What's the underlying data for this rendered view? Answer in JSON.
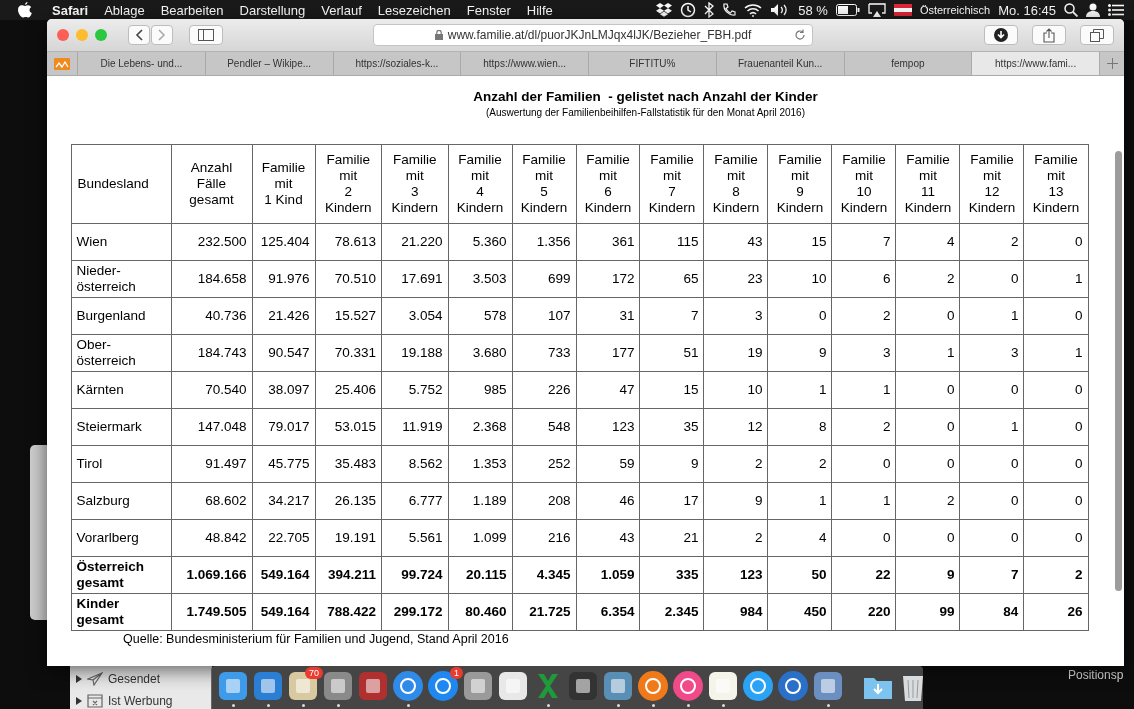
{
  "menubar": {
    "app": "Safari",
    "items": [
      "Ablage",
      "Bearbeiten",
      "Darstellung",
      "Verlauf",
      "Lesezeichen",
      "Fenster",
      "Hilfe"
    ],
    "battery": "58 %",
    "input_source": "Österreichisch",
    "clock": "Mo. 16:45"
  },
  "browser": {
    "url": "www.familie.at/dl/puorJKJnLMJqx4lJK/Bezieher_FBH.pdf",
    "tabs": [
      {
        "label": "Die Lebens- und...",
        "selected": false
      },
      {
        "label": "Pendler – Wikipe...",
        "selected": false
      },
      {
        "label": "https://soziales-k...",
        "selected": false
      },
      {
        "label": "https://www.wien...",
        "selected": false
      },
      {
        "label": "FIFTITU%",
        "selected": false
      },
      {
        "label": "Frauenanteil Kun...",
        "selected": false
      },
      {
        "label": "fempop",
        "selected": false
      },
      {
        "label": "https://www.fami...",
        "selected": true
      }
    ]
  },
  "document": {
    "title": "Anzahl der Familien  - gelistet nach Anzahl der Kinder",
    "subtitle": "(Auswertung der Familienbeihilfen-Fallstatistik für den Monat April 2016)",
    "columns": [
      "Bundesland",
      "Anzahl\nFälle\ngesamt",
      "Familie\nmit\n1 Kind",
      "Familie\nmit\n2\nKindern",
      "Familie\nmit\n3\nKindern",
      "Familie\nmit\n4\nKindern",
      "Familie\nmit\n5\nKindern",
      "Familie\nmit\n6\nKindern",
      "Familie\nmit\n7\nKindern",
      "Familie\nmit\n8\nKindern",
      "Familie\nmit\n9\nKindern",
      "Familie\nmit\n10\nKindern",
      "Familie\nmit\n11\nKindern",
      "Familie\nmit\n12\nKindern",
      "Familie\nmit\n13\nKindern"
    ],
    "rows": [
      {
        "kind": "state",
        "cells": [
          "Wien",
          "232.500",
          "125.404",
          "78.613",
          "21.220",
          "5.360",
          "1.356",
          "361",
          "115",
          "43",
          "15",
          "7",
          "4",
          "2",
          "0"
        ]
      },
      {
        "kind": "state",
        "cells": [
          "Nieder-\nösterreich",
          "184.658",
          "91.976",
          "70.510",
          "17.691",
          "3.503",
          "699",
          "172",
          "65",
          "23",
          "10",
          "6",
          "2",
          "0",
          "1"
        ]
      },
      {
        "kind": "state",
        "cells": [
          "Burgenland",
          "40.736",
          "21.426",
          "15.527",
          "3.054",
          "578",
          "107",
          "31",
          "7",
          "3",
          "0",
          "2",
          "0",
          "1",
          "0"
        ]
      },
      {
        "kind": "state",
        "cells": [
          "Ober-\nösterreich",
          "184.743",
          "90.547",
          "70.331",
          "19.188",
          "3.680",
          "733",
          "177",
          "51",
          "19",
          "9",
          "3",
          "1",
          "3",
          "1"
        ]
      },
      {
        "kind": "state",
        "cells": [
          "Kärnten",
          "70.540",
          "38.097",
          "25.406",
          "5.752",
          "985",
          "226",
          "47",
          "15",
          "10",
          "1",
          "1",
          "0",
          "0",
          "0"
        ]
      },
      {
        "kind": "state",
        "cells": [
          "Steiermark",
          "147.048",
          "79.017",
          "53.015",
          "11.919",
          "2.368",
          "548",
          "123",
          "35",
          "12",
          "8",
          "2",
          "0",
          "1",
          "0"
        ]
      },
      {
        "kind": "state",
        "cells": [
          "Tirol",
          "91.497",
          "45.775",
          "35.483",
          "8.562",
          "1.353",
          "252",
          "59",
          "9",
          "2",
          "2",
          "0",
          "0",
          "0",
          "0"
        ]
      },
      {
        "kind": "state",
        "cells": [
          "Salzburg",
          "68.602",
          "34.217",
          "26.135",
          "6.777",
          "1.189",
          "208",
          "46",
          "17",
          "9",
          "1",
          "1",
          "2",
          "0",
          "0"
        ]
      },
      {
        "kind": "state",
        "cells": [
          "Vorarlberg",
          "48.842",
          "22.705",
          "19.191",
          "5.561",
          "1.099",
          "216",
          "43",
          "21",
          "2",
          "4",
          "0",
          "0",
          "0",
          "0"
        ]
      },
      {
        "kind": "total",
        "cells": [
          "Österreich\ngesamt",
          "1.069.166",
          "549.164",
          "394.211",
          "99.724",
          "20.115",
          "4.345",
          "1.059",
          "335",
          "123",
          "50",
          "22",
          "9",
          "7",
          "2"
        ]
      },
      {
        "kind": "total",
        "cells": [
          "Kinder\ngesamt",
          "1.749.505",
          "549.164",
          "788.422",
          "299.172",
          "80.460",
          "21.725",
          "6.354",
          "2.345",
          "984",
          "450",
          "220",
          "99",
          "84",
          "26"
        ]
      }
    ],
    "source": "Quelle: Bundesministerium für Familien und Jugend, Stand April 2016"
  },
  "mail": {
    "folders": [
      "Gesendet",
      "Ist Werbung"
    ]
  },
  "side_text": "Positionsp",
  "dock": {
    "items": [
      {
        "running": true
      },
      {
        "running": true
      },
      {
        "running": true,
        "badge": "70"
      },
      {
        "running": true
      },
      {
        "running": false
      },
      {
        "running": true
      },
      {
        "running": false,
        "badge": "1"
      },
      {
        "running": false
      },
      {
        "running": false
      },
      {
        "running": true
      },
      {
        "running": false
      },
      {
        "running": true
      },
      {
        "running": true
      },
      {
        "running": true
      },
      {
        "running": true
      },
      {
        "running": false
      },
      {
        "running": false
      },
      {
        "running": true
      },
      {
        "running": false
      },
      {
        "running": false
      }
    ]
  }
}
